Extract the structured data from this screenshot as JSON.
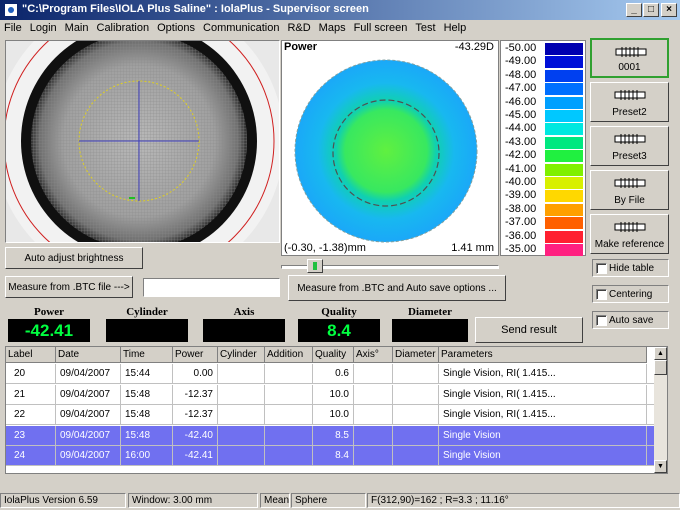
{
  "window": {
    "title": "\"C:\\Program Files\\IOLA Plus Saline\" : IolaPlus - Supervisor screen"
  },
  "menu": [
    "File",
    "Login",
    "Main",
    "Calibration",
    "Options",
    "Communication",
    "R&D",
    "Maps",
    "Full screen",
    "Test",
    "Help"
  ],
  "powermap": {
    "title": "Power",
    "value": "-43.29D",
    "coords": "(-0.30, -1.38)mm",
    "radius": "1.41 mm"
  },
  "scale": {
    "labels": [
      "-50.00",
      "-49.00",
      "-48.00",
      "-47.00",
      "-46.00",
      "-45.00",
      "-44.00",
      "-43.00",
      "-42.00",
      "-41.00",
      "-40.00",
      "-39.00",
      "-38.00",
      "-37.00",
      "-36.00",
      "-35.00"
    ],
    "colors": [
      "#0000b0",
      "#0010d8",
      "#0040f0",
      "#0070ff",
      "#00a0ff",
      "#00c8ff",
      "#00e8e0",
      "#00e880",
      "#20f040",
      "#80f000",
      "#d8f000",
      "#ffd800",
      "#ffa000",
      "#ff6000",
      "#ff2030",
      "#ff2080"
    ]
  },
  "side_buttons": [
    "0001",
    "Preset2",
    "Preset3",
    "By File",
    "Make reference"
  ],
  "checkboxes": [
    "Hide table",
    "Centering",
    "Auto save"
  ],
  "buttons": {
    "auto_adjust": "Auto adjust brightness",
    "measure_btc": "Measure from .BTC file --->",
    "measure_btc_auto": "Measure from .BTC and Auto save options ...",
    "send_result": "Send result"
  },
  "file_field": {
    "value": ""
  },
  "results": {
    "power_label": "Power",
    "power_value": "-42.41",
    "cylinder_label": "Cylinder",
    "cylinder_value": "",
    "axis_label": "Axis",
    "axis_value": "",
    "quality_label": "Quality",
    "quality_value": "8.4",
    "diameter_label": "Diameter",
    "diameter_value": ""
  },
  "table": {
    "columns": [
      "Label",
      "Date",
      "Time",
      "Power",
      "Cylinder",
      "Addition",
      "Quality",
      "Axis°",
      "Diameter",
      "Parameters"
    ],
    "rows": [
      [
        "20",
        "09/04/2007",
        "15:44",
        "0.00",
        "",
        "",
        "0.6",
        "",
        "",
        "Single Vision, RI( 1.415..."
      ],
      [
        "21",
        "09/04/2007",
        "15:48",
        "-12.37",
        "",
        "",
        "10.0",
        "",
        "",
        "Single Vision, RI( 1.415..."
      ],
      [
        "22",
        "09/04/2007",
        "15:48",
        "-12.37",
        "",
        "",
        "10.0",
        "",
        "",
        "Single Vision, RI( 1.415..."
      ],
      [
        "23",
        "09/04/2007",
        "15:48",
        "-42.40",
        "",
        "",
        "8.5",
        "",
        "",
        "Single Vision"
      ],
      [
        "24",
        "09/04/2007",
        "16:00",
        "-42.41",
        "",
        "",
        "8.4",
        "",
        "",
        "Single Vision"
      ]
    ],
    "selected_rows": [
      3,
      4
    ]
  },
  "status": {
    "version": "IolaPlus Version 6.59",
    "window": "Window: 3.00 mm",
    "mode": "Mean",
    "shape": "Sphere",
    "readout": "F(312,90)=162 ; R=3.3 ; 11.16°"
  }
}
